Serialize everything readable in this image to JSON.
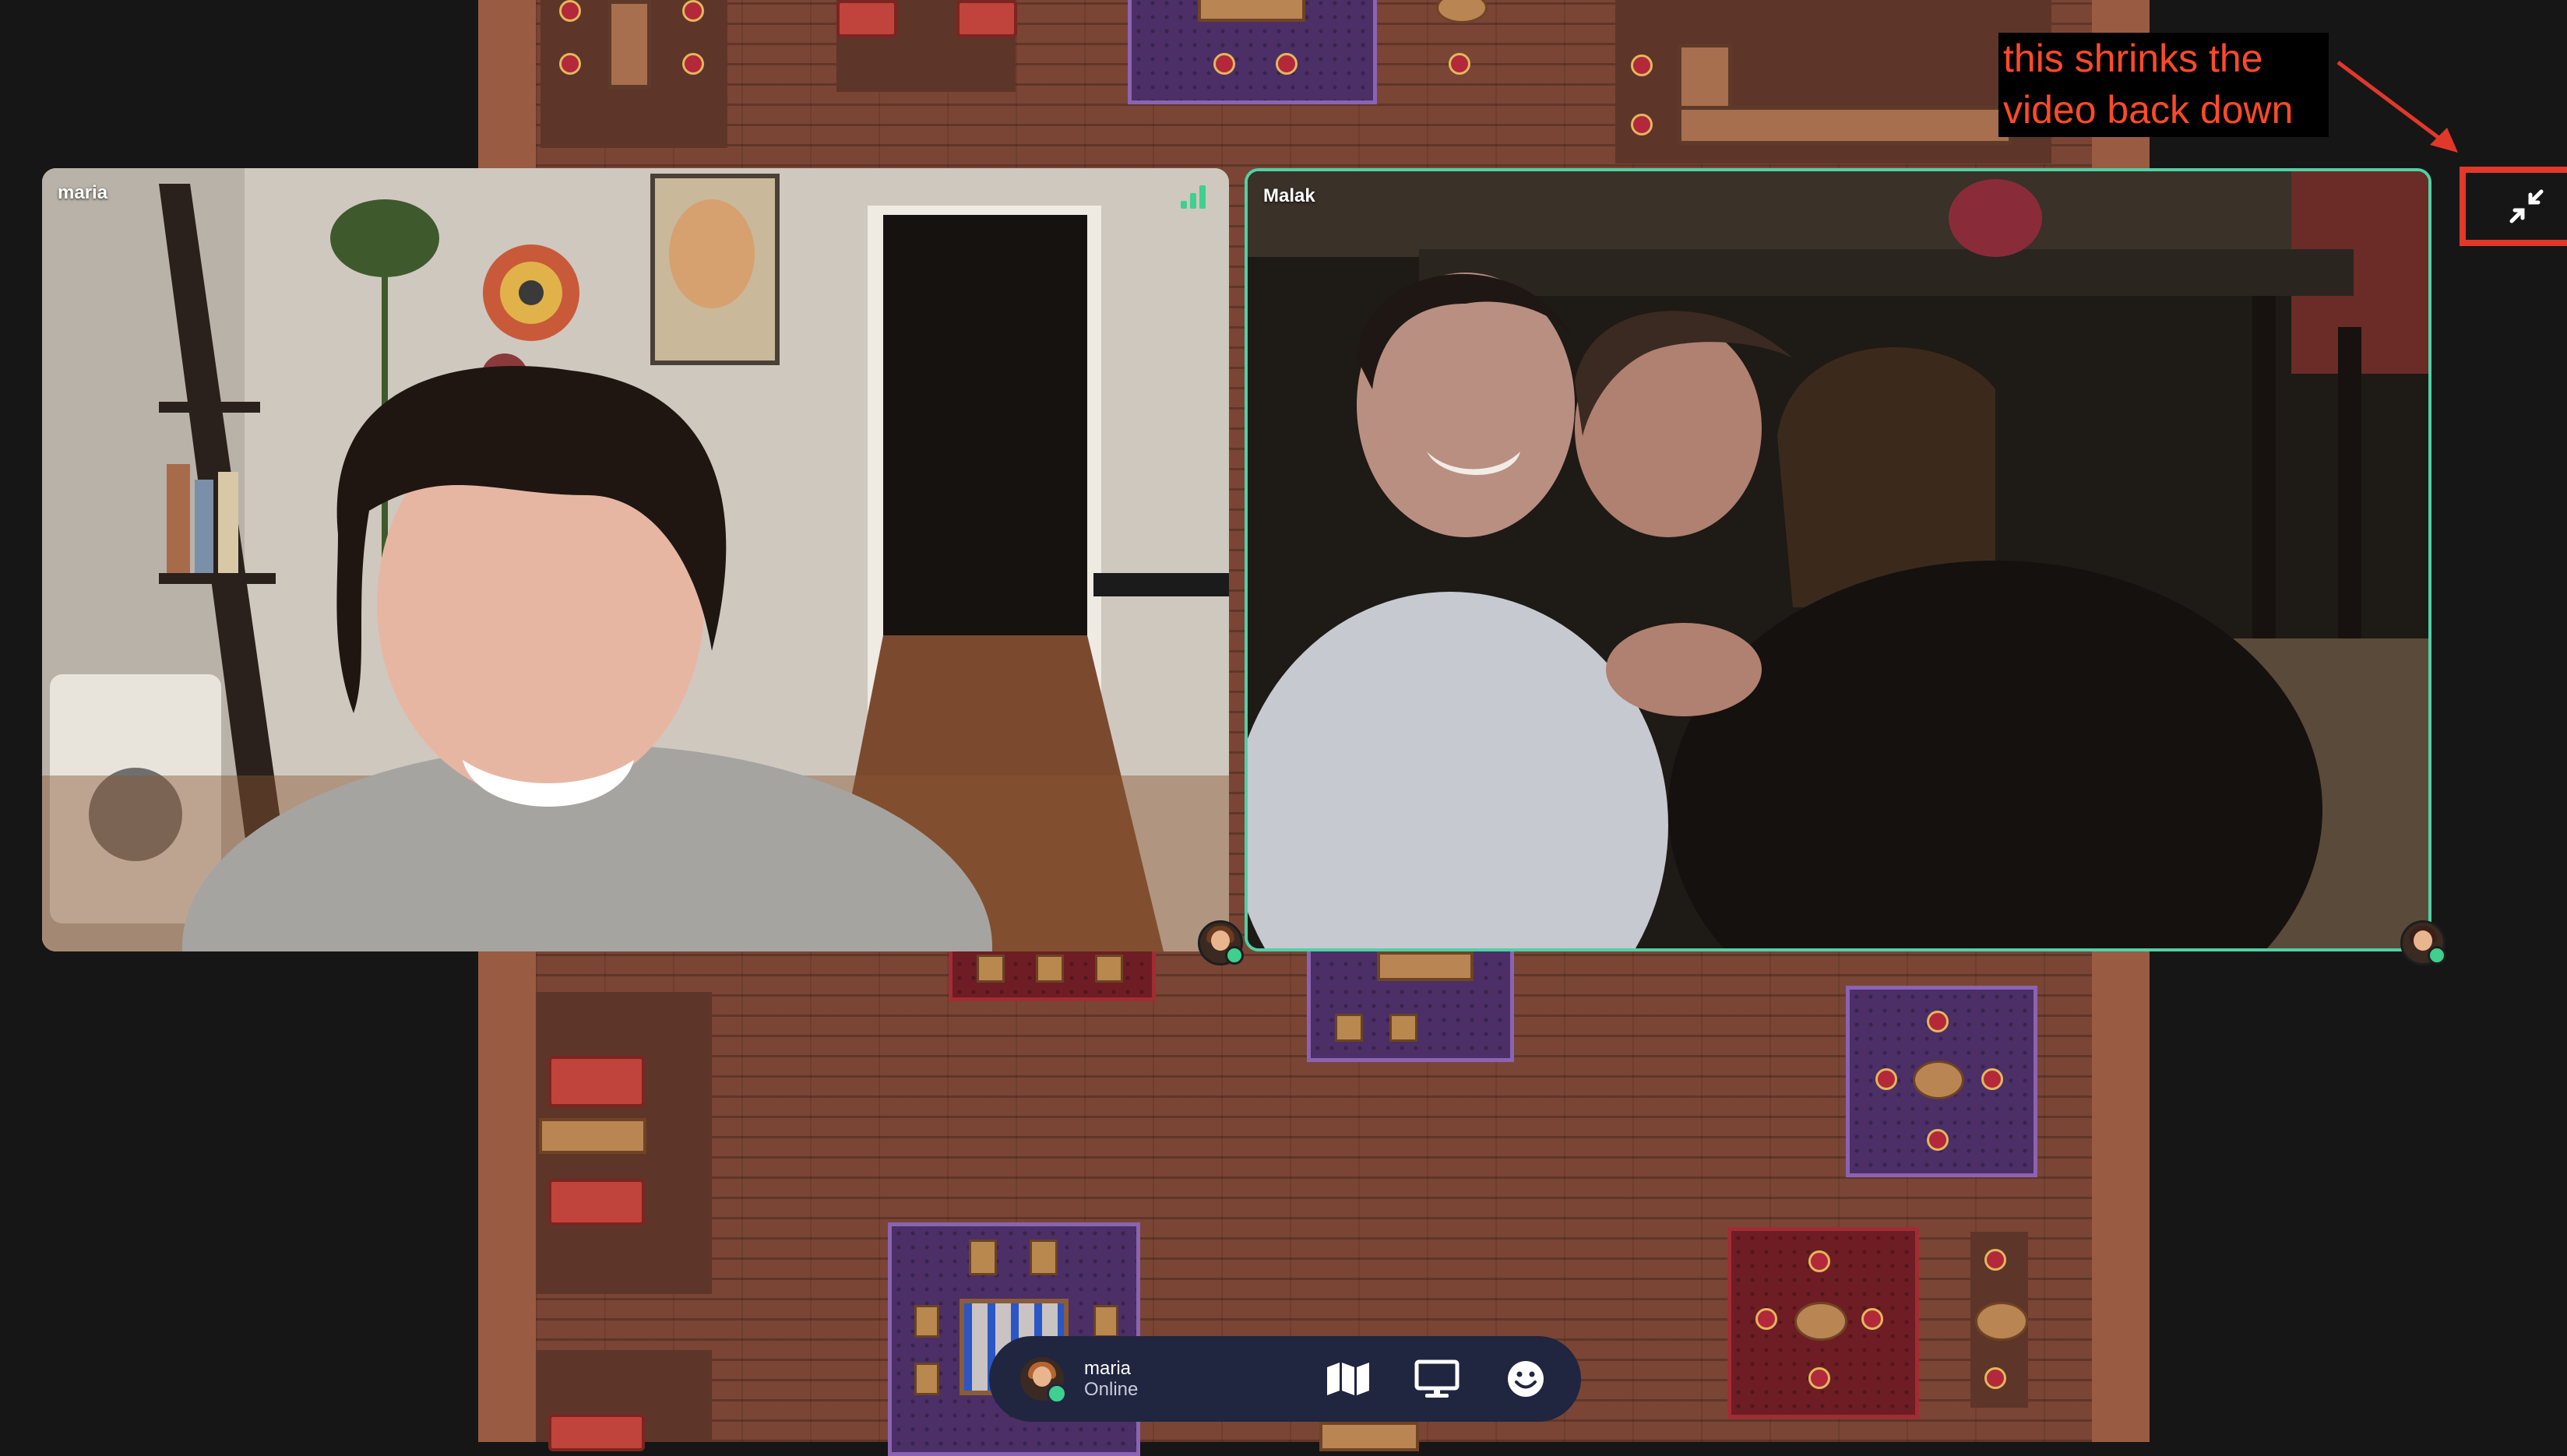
{
  "videos": [
    {
      "name": "maria",
      "signal_bars": 3
    },
    {
      "name": "Malak"
    }
  ],
  "annotation": {
    "line1": "this shrinks the",
    "line2": "video back down",
    "color": "#ff4a2a"
  },
  "controls": {
    "shrink_icon": "minimize-arrows-icon"
  },
  "bottom_bar": {
    "user_name": "maria",
    "status": "Online",
    "icons": [
      "map-icon",
      "screen-share-icon",
      "emoji-icon"
    ]
  },
  "colors": {
    "active_speaker_border": "#4fd1a5",
    "online": "#3fcf8e",
    "highlight": "#e2382a",
    "bar_bg": "#202540"
  }
}
